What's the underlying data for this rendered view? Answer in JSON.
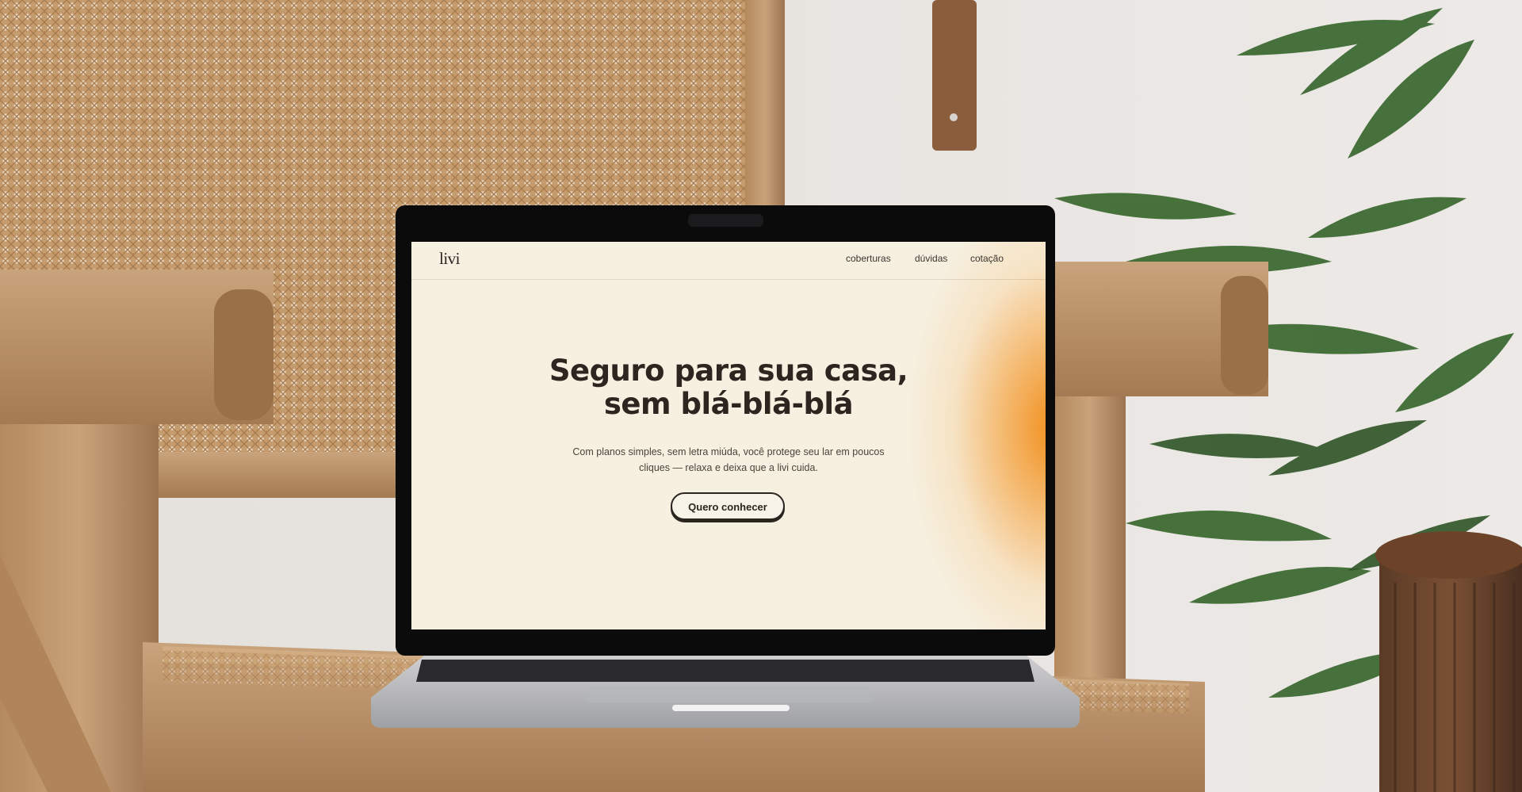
{
  "site": {
    "logo": "livi",
    "nav": [
      {
        "label": "coberturas"
      },
      {
        "label": "dúvidas"
      },
      {
        "label": "cotação"
      }
    ],
    "hero": {
      "title_line1": "Seguro para sua casa,",
      "title_line2": "sem blá-blá-blá",
      "subtitle_line1": "Com planos simples, sem letra miúda, você protege seu lar em poucos",
      "subtitle_line2": "cliques — relaxa e deixa que a livi cuida.",
      "cta_label": "Quero conhecer"
    }
  },
  "colors": {
    "page_background": "#f6f0e0",
    "accent_gradient": "#f18a14",
    "text_dark": "#2c2520"
  }
}
